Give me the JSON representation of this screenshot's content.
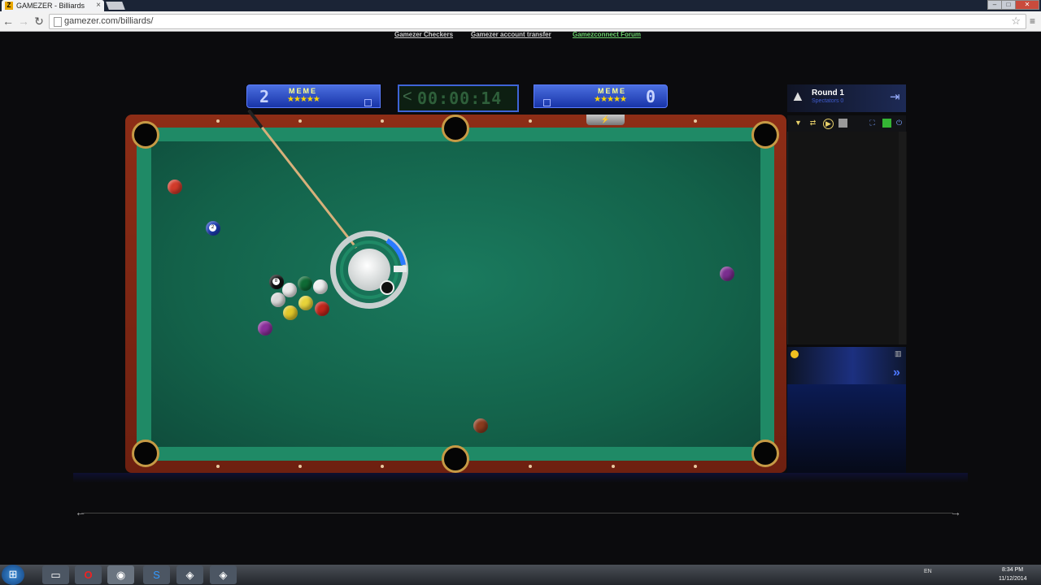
{
  "browser": {
    "tab_title": "GAMEZER - Billiards",
    "tab_favicon": "Z",
    "tab_close": "×",
    "url": "gamezer.com/billiards/",
    "window_min": "–",
    "window_max": "□",
    "window_close": "✕"
  },
  "top_links": {
    "checkers": "Gamezer Checkers",
    "transfer": "Gamezer account transfer",
    "forum": "Gamezconnect Forum"
  },
  "scoreboard": {
    "player1": {
      "score": "2",
      "name": "MEME",
      "stars": "★★★★★"
    },
    "player2": {
      "score": "0",
      "name": "MEME",
      "stars": "★★★★★"
    },
    "timer_arrow": "<",
    "timer": "00:00:14"
  },
  "right_panel": {
    "round_title": "Round 1",
    "round_sub": "Spectators 0",
    "send_icon": "»"
  },
  "table": {
    "felt_color": "#136149",
    "rail_color": "#8d2d16",
    "balls": [
      {
        "id": "red-solid",
        "color": "#d23a2a",
        "label": ""
      },
      {
        "id": "blue-2",
        "color": "#1d3fb7",
        "label": "2"
      },
      {
        "id": "purple-stripe",
        "color": "#7a2e8f",
        "label": ""
      },
      {
        "id": "black-8",
        "color": "#111111",
        "label": "8"
      },
      {
        "id": "white-stripe",
        "color": "#e9e9e9",
        "label": ""
      },
      {
        "id": "green",
        "color": "#0f6b35",
        "label": ""
      },
      {
        "id": "white-2",
        "color": "#eeeeee",
        "label": ""
      },
      {
        "id": "stripe-gray",
        "color": "#d8d8d8",
        "label": ""
      },
      {
        "id": "yellow-stripe",
        "color": "#e7d33a",
        "label": ""
      },
      {
        "id": "red-2",
        "color": "#c0261b",
        "label": ""
      },
      {
        "id": "yellow",
        "color": "#e1c729",
        "label": ""
      },
      {
        "id": "purple",
        "color": "#8a2f9a",
        "label": ""
      },
      {
        "id": "brown",
        "color": "#8a3b1e",
        "label": ""
      }
    ]
  },
  "taskbar": {
    "language": "EN",
    "time": "8:34 PM",
    "date": "11/12/2014"
  }
}
